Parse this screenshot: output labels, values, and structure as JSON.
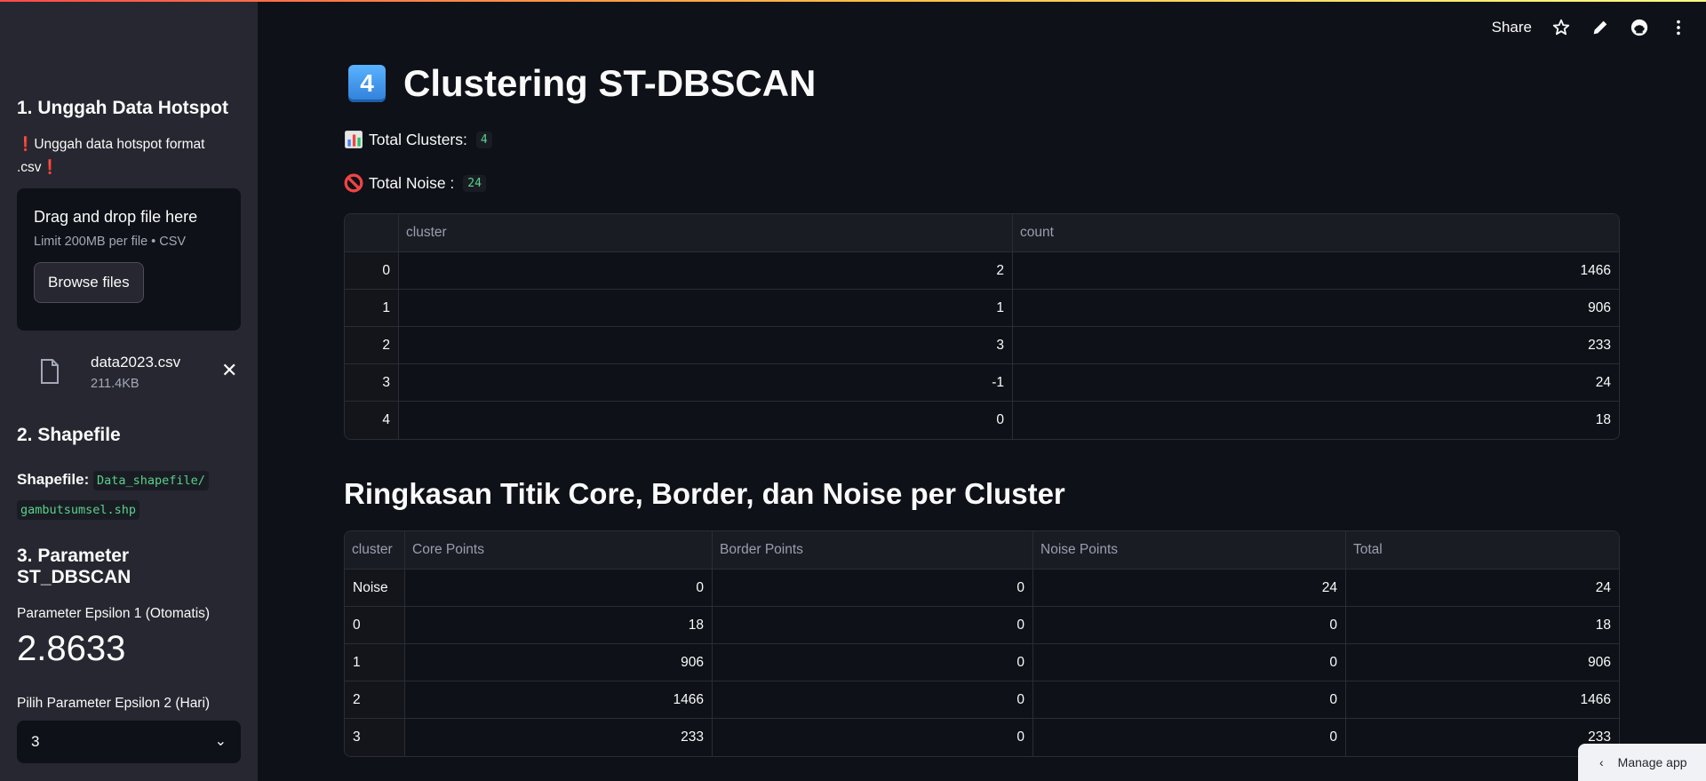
{
  "sidebar": {
    "section1_title": "1. Unggah Data Hotspot",
    "upload_note_text": "Unggah data hotspot format .csv",
    "uploader": {
      "drag_drop_text": "Drag and drop file here",
      "limit_text": "Limit 200MB per file • CSV",
      "browse_label": "Browse files"
    },
    "file": {
      "name": "data2023.csv",
      "size": "211.4KB"
    },
    "section2_title": "2. Shapefile",
    "shapefile_label": "Shapefile:",
    "shapefile_path_1": "Data_shapefile/",
    "shapefile_path_2": "gambutsumsel.shp",
    "section3_title": "3. Parameter ST_DBSCAN",
    "eps1_label": "Parameter Epsilon 1 (Otomatis)",
    "eps1_value": "2.8633",
    "eps2_label": "Pilih Parameter Epsilon 2 (Hari)",
    "eps2_selected": "3"
  },
  "header": {
    "share_label": "Share"
  },
  "main": {
    "title_keycap": "4",
    "title": "Clustering ST-DBSCAN",
    "total_clusters_label": "Total Clusters:",
    "total_clusters_value": "4",
    "total_noise_label": "Total Noise :",
    "total_noise_value": "24",
    "count_table": {
      "columns": [
        "cluster",
        "count"
      ],
      "rows": [
        {
          "index": "0",
          "cluster": "2",
          "count": "1466"
        },
        {
          "index": "1",
          "cluster": "1",
          "count": "906"
        },
        {
          "index": "2",
          "cluster": "3",
          "count": "233"
        },
        {
          "index": "3",
          "cluster": "-1",
          "count": "24"
        },
        {
          "index": "4",
          "cluster": "0",
          "count": "18"
        }
      ]
    },
    "summary_title": "Ringkasan Titik Core, Border, dan Noise per Cluster",
    "summary_table": {
      "columns": [
        "cluster",
        "Core Points",
        "Border Points",
        "Noise Points",
        "Total"
      ],
      "rows": [
        {
          "cluster": "Noise",
          "core": "0",
          "border": "0",
          "noise": "24",
          "total": "24"
        },
        {
          "cluster": "0",
          "core": "18",
          "border": "0",
          "noise": "0",
          "total": "18"
        },
        {
          "cluster": "1",
          "core": "906",
          "border": "0",
          "noise": "0",
          "total": "906"
        },
        {
          "cluster": "2",
          "core": "1466",
          "border": "0",
          "noise": "0",
          "total": "1466"
        },
        {
          "cluster": "3",
          "core": "233",
          "border": "0",
          "noise": "0",
          "total": "233"
        }
      ]
    }
  },
  "footer": {
    "manage_app_label": "Manage app"
  }
}
